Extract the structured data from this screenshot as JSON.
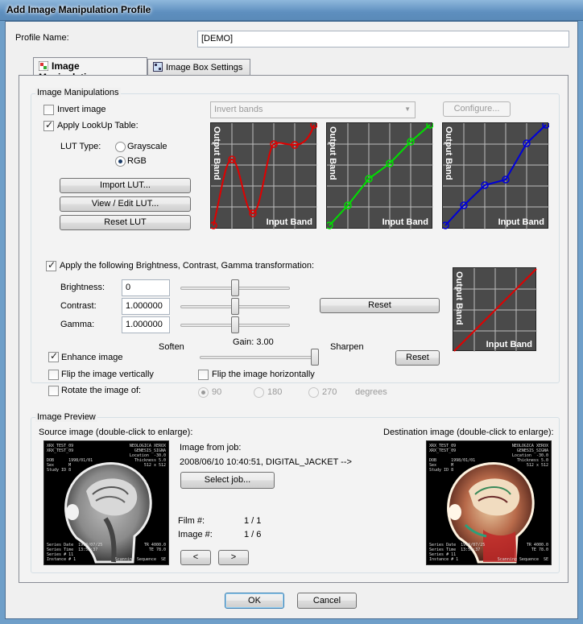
{
  "window": {
    "title": "Add Image Manipulation Profile"
  },
  "profile": {
    "label": "Profile Name:",
    "value": "[DEMO]"
  },
  "tabs": [
    {
      "label": "Image Manipulations",
      "active": true,
      "icon": "image-manipulation-icon"
    },
    {
      "label": "Image Box Settings",
      "active": false,
      "icon": "image-box-icon"
    }
  ],
  "manip": {
    "group_title": "Image Manipulations",
    "invert_image": {
      "label": "Invert image",
      "checked": false
    },
    "invert_bands": "Invert bands",
    "configure": "Configure...",
    "apply_lut": {
      "label": "Apply LookUp Table:",
      "checked": true
    },
    "lut_type_label": "LUT Type:",
    "grayscale": {
      "label": "Grayscale",
      "checked": false
    },
    "rgb": {
      "label": "RGB",
      "checked": true
    },
    "import_lut": "Import LUT...",
    "view_edit_lut": "View / Edit LUT...",
    "reset_lut": "Reset LUT",
    "lut_axis_output": "Output Band",
    "lut_axis_input": "Input Band",
    "lut_colors": {
      "red": "#e00000",
      "green": "#00e000",
      "blue": "#0000d8",
      "grid": "#bdbdbd",
      "bg": "#4a4a4a"
    },
    "apply_bcg": {
      "label": "Apply the following Brightness, Contrast, Gamma transformation:",
      "checked": true
    },
    "brightness": {
      "label": "Brightness:",
      "value": "0"
    },
    "contrast": {
      "label": "Contrast:",
      "value": "1.000000"
    },
    "gamma": {
      "label": "Gamma:",
      "value": "1.000000"
    },
    "bcg_reset": "Reset",
    "soften": "Soften",
    "gain": "Gain: 3.00",
    "sharpen": "Sharpen",
    "enhance": {
      "label": "Enhance image",
      "checked": true
    },
    "enhance_reset": "Reset",
    "flip_v": {
      "label": "Flip the image vertically",
      "checked": false
    },
    "flip_h": {
      "label": "Flip the image horizontally",
      "checked": false
    },
    "rotate": {
      "label": "Rotate the image of:",
      "checked": false
    },
    "rot_90": "90",
    "rot_180": "180",
    "rot_270": "270",
    "degrees": "degrees"
  },
  "preview": {
    "group_title": "Image Preview",
    "source_label": "Source image (double-click to enlarge):",
    "dest_label": "Destination image (double-click to enlarge):",
    "from_job_label": "Image from job:",
    "job_value": "2008/06/10 10:40:51, DIGITAL_JACKET -->",
    "select_job": "Select job...",
    "film_label": "Film #:",
    "film_value": "1 / 1",
    "image_label": "Image #:",
    "image_value": "1 / 6",
    "prev": "<",
    "next": ">",
    "mri_tl": "XRX_TEST_09\nXRX_TEST_09\n\nDOB      1998/01/01\nSex      M\nStudy ID 8",
    "mri_tr": "NEOLOGICA XEROX\nGENESIS_SIGNA\nLocation  -30.0\nThickness 5.0\n512 x 512",
    "mri_bl": "Series Date  1998/07/25\nSeries Time  13:52:37\nSeries # 11\nInstance # 1",
    "mri_br": "TR 4000.0\nTE 78.0\n\nScanning Sequence  SE"
  },
  "footer": {
    "ok": "OK",
    "cancel": "Cancel"
  }
}
